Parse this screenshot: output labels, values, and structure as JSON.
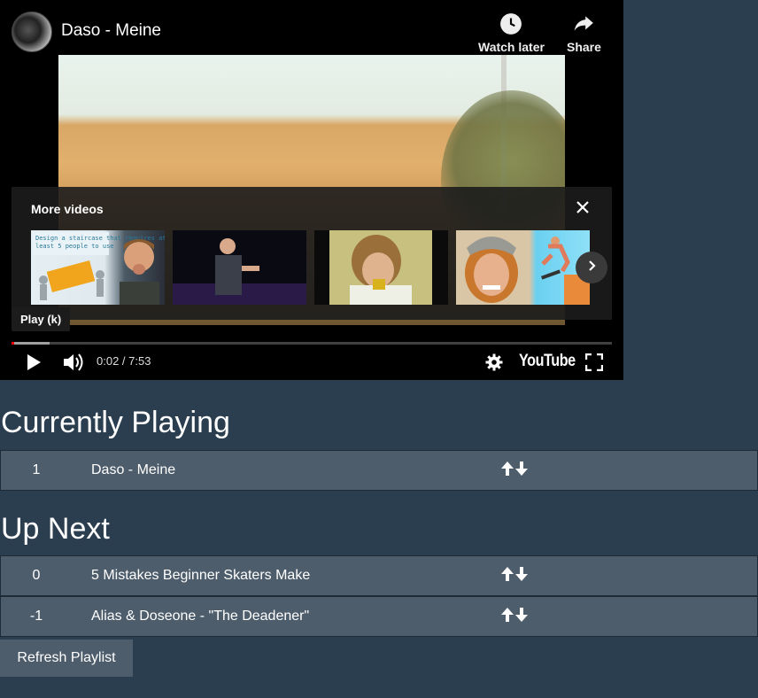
{
  "player": {
    "video_title": "Daso - Meine",
    "watch_later_label": "Watch later",
    "share_label": "Share",
    "more_videos_label": "More videos",
    "tooltip": "Play (k)",
    "time_display": "0:02 / 7:53",
    "youtube_logo": "YouTube",
    "progress_fraction": 0.004,
    "buffered_fraction": 0.063,
    "icons": [
      "clock-icon",
      "share-arrow-icon",
      "close-icon",
      "chevron-right-icon",
      "play-icon",
      "volume-icon",
      "gear-icon",
      "fullscreen-icon"
    ],
    "thumbnail_text": "Design a staircase that requires at least 5 people to use"
  },
  "currently_playing": {
    "heading": "Currently Playing",
    "rows": [
      {
        "num": "1",
        "title": "Daso - Meine"
      }
    ]
  },
  "up_next": {
    "heading": "Up Next",
    "rows": [
      {
        "num": "0",
        "title": "5 Mistakes Beginner Skaters Make"
      },
      {
        "num": "-1",
        "title": "Alias & Doseone - \"The Deadener\""
      }
    ]
  },
  "refresh_label": "Refresh Playlist",
  "colors": {
    "page_bg": "#2b3e50",
    "row_bg": "#4e5d6c",
    "progress_red": "#ff0000"
  }
}
